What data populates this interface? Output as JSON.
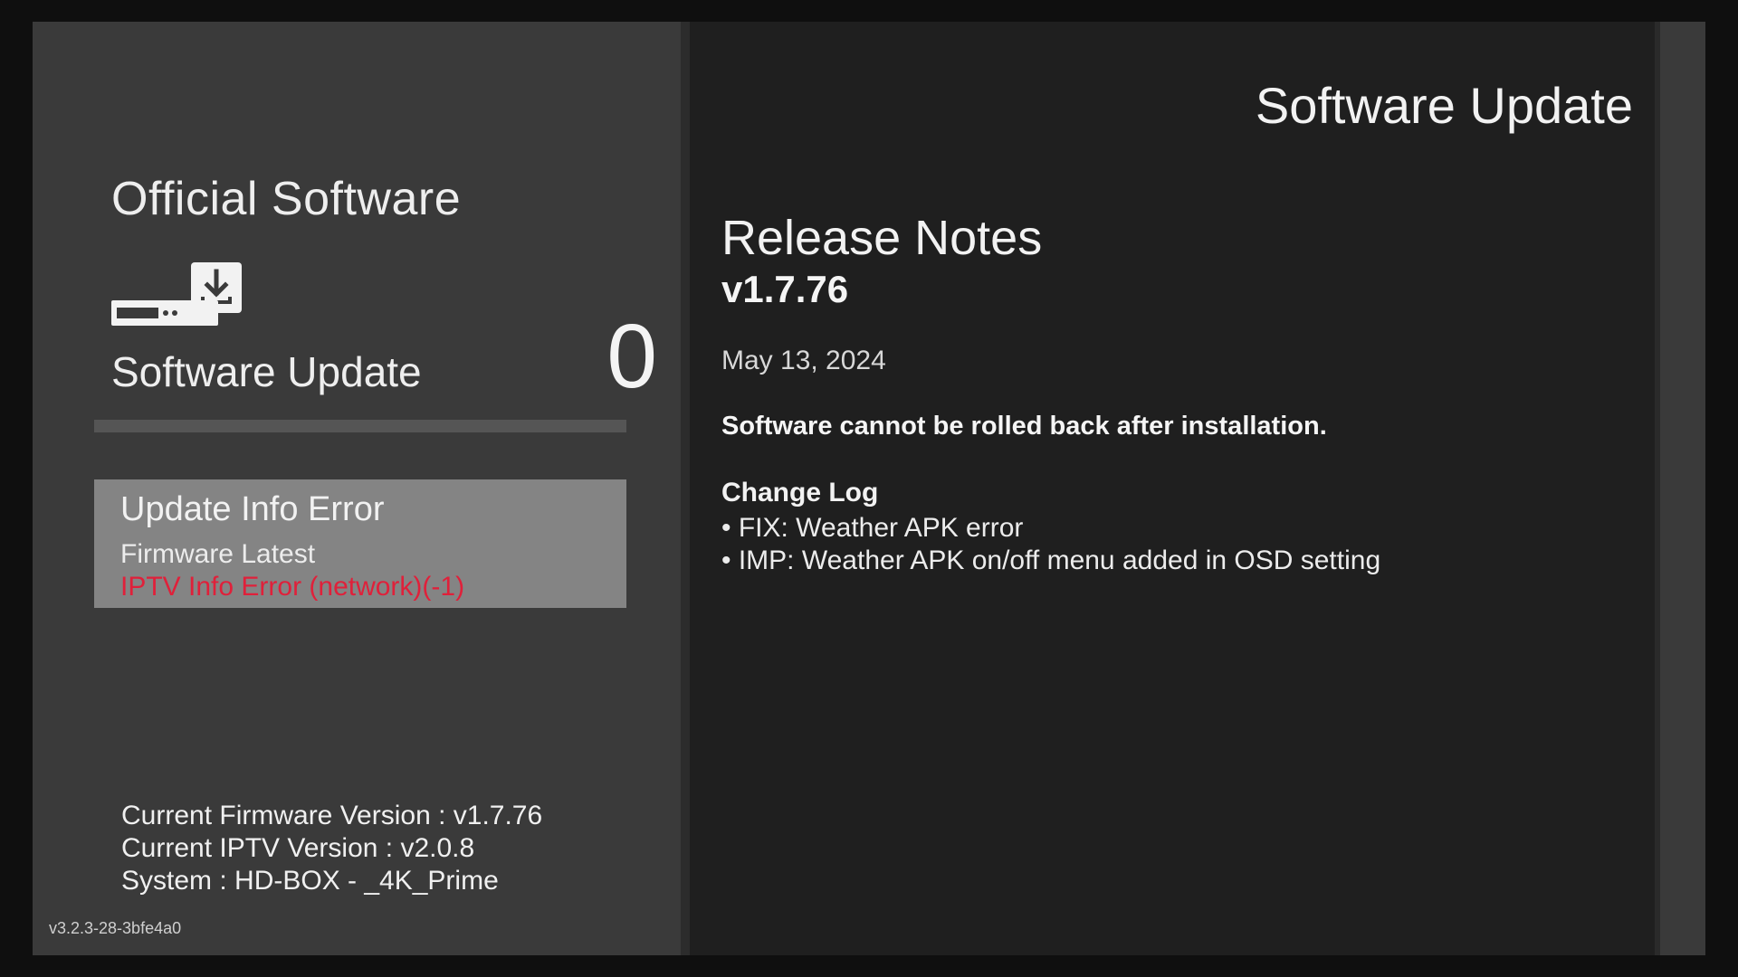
{
  "left": {
    "section_title": "Official Software",
    "update_label": "Software Update",
    "update_count": "0",
    "progress_percent": 0,
    "status": {
      "title": "Update Info Error",
      "line1": "Firmware Latest",
      "line2": "IPTV Info Error (network)(-1)",
      "error_color": "#e0203a"
    },
    "info": {
      "firmware": "Current Firmware Version : v1.7.76",
      "iptv": "Current IPTV Version : v2.0.8",
      "system": "System : HD-BOX - _4K_Prime"
    },
    "build_tag": "v3.2.3-28-3bfe4a0"
  },
  "right": {
    "header_title": "Software Update",
    "release_heading": "Release Notes",
    "version": "v1.7.76",
    "date": "May 13, 2024",
    "warning": "Software cannot be rolled back after installation.",
    "changelog_title": "Change Log",
    "changelog": [
      "• FIX: Weather APK error",
      "• IMP: Weather APK on/off menu added in OSD setting"
    ]
  },
  "icons": {
    "device": "set-top-box-download-icon"
  }
}
